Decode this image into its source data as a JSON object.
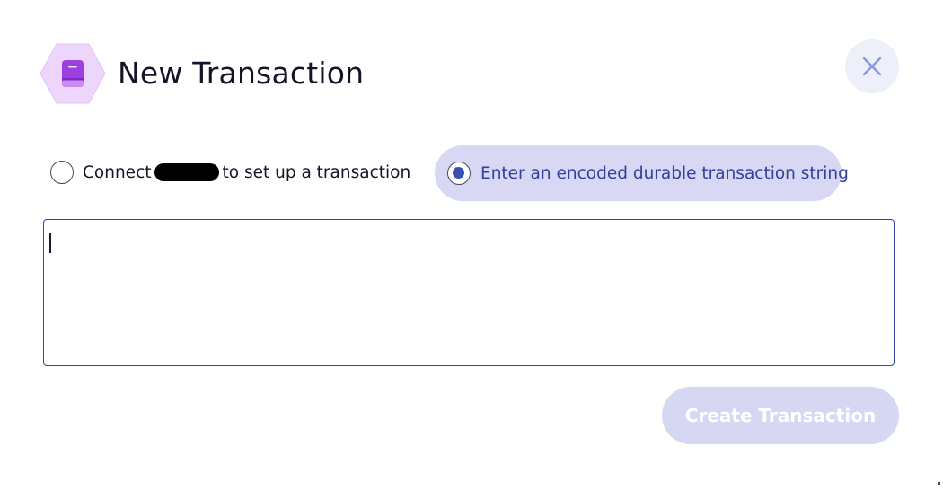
{
  "header": {
    "title": "New Transaction",
    "icon": "book-icon",
    "icon_badge_color": "#eed5fb",
    "icon_color": "#9b3fe0"
  },
  "close": {
    "icon": "close-icon",
    "background": "#edeff9",
    "color": "#8a96e0"
  },
  "options": {
    "connect": {
      "selected": false,
      "label_before": "Connect",
      "label_after": "to set up a transaction"
    },
    "durable": {
      "selected": true,
      "label": "Enter an encoded durable transaction string"
    }
  },
  "transaction_input": {
    "value": "",
    "placeholder": ""
  },
  "actions": {
    "create_label": "Create Transaction",
    "enabled": false
  },
  "colors": {
    "accent": "#3346a8",
    "selected_option_bg": "#d8d8f5",
    "button_disabled_bg": "#d6d8f3",
    "text_primary": "#141428"
  }
}
